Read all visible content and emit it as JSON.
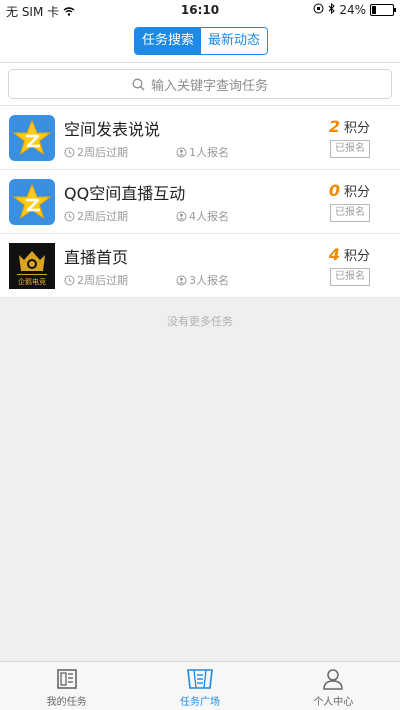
{
  "status": {
    "carrier": "无 SIM 卡",
    "time": "16:10",
    "battery": "24%",
    "battery_level": 0.24
  },
  "nav": {
    "tabs": [
      "任务搜索",
      "最新动态"
    ],
    "active_tab": 0
  },
  "search": {
    "placeholder": "输入关键字查询任务"
  },
  "tasks": [
    {
      "title": "空间发表说说",
      "expire": "2周后过期",
      "registered": "1人报名",
      "points": "2",
      "points_unit": "积分",
      "status": "已报名",
      "icon": "qzone-star-icon"
    },
    {
      "title": "QQ空间直播互动",
      "expire": "2周后过期",
      "registered": "4人报名",
      "points": "0",
      "points_unit": "积分",
      "status": "已报名",
      "icon": "qzone-star-icon"
    },
    {
      "title": "直播首页",
      "expire": "2周后过期",
      "registered": "3人报名",
      "points": "4",
      "points_unit": "积分",
      "status": "已报名",
      "icon": "esports-logo-icon",
      "logo_text": "企鹅电竞"
    }
  ],
  "no_more": "没有更多任务",
  "tabbar": {
    "items": [
      "我的任务",
      "任务广场",
      "个人中心"
    ],
    "active": 1
  },
  "colors": {
    "accent": "#1d8ae6",
    "points": "#f08a00"
  }
}
